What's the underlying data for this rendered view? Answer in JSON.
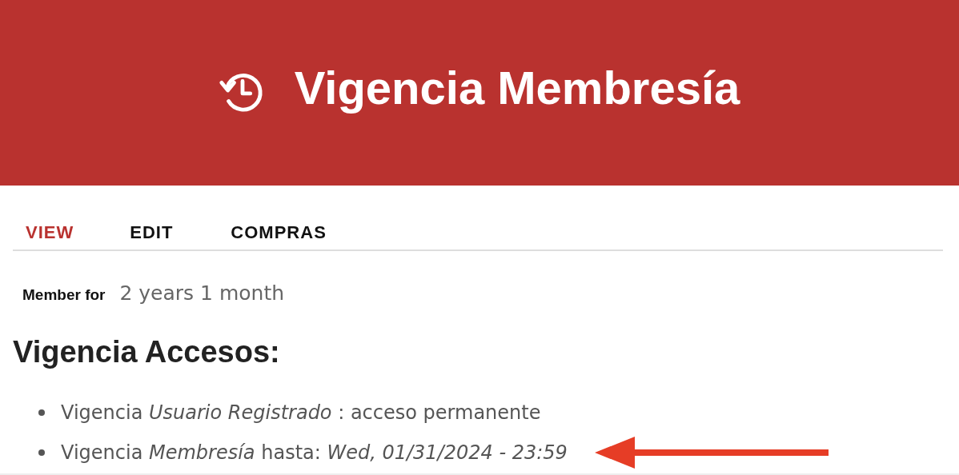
{
  "header": {
    "title": "Vigencia Membresía"
  },
  "tabs": [
    {
      "label": "VIEW",
      "selected": true
    },
    {
      "label": "EDIT",
      "selected": false
    },
    {
      "label": "COMPRAS",
      "selected": false
    }
  ],
  "member_for": {
    "label": "Member for",
    "value": "2 years 1 month"
  },
  "section": {
    "heading": "Vigencia Accesos:",
    "items": [
      {
        "text": "Vigencia *Usuario Registrado* : acceso permanente",
        "annotated": false
      },
      {
        "text": "Vigencia *Membresía* hasta: *Wed, 01/31/2024 - 23:59*",
        "annotated": true
      }
    ]
  }
}
